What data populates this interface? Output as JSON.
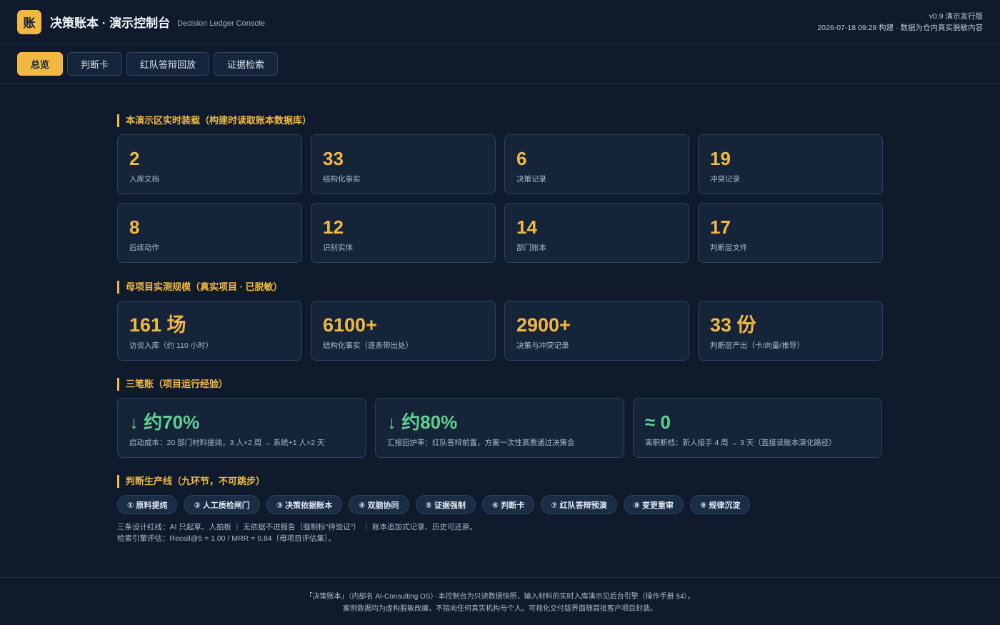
{
  "header": {
    "logo_char": "账",
    "title": "决策账本 · 演示控制台",
    "subtitle": "Decision Ledger Console",
    "version": "v0.9 演示发行版",
    "build_info": "2026-07-18 09:29 构建 · 数据为仓内真实脱敏内容"
  },
  "tabs": [
    {
      "label": "总览",
      "active": true
    },
    {
      "label": "判断卡",
      "active": false
    },
    {
      "label": "红队答辩回放",
      "active": false
    },
    {
      "label": "证据检索",
      "active": false
    }
  ],
  "section_live": {
    "title": "本演示区实时装载（构建时读取账本数据库）",
    "cards": [
      {
        "value": "2",
        "label": "入库文档"
      },
      {
        "value": "33",
        "label": "结构化事实"
      },
      {
        "value": "6",
        "label": "决策记录"
      },
      {
        "value": "19",
        "label": "冲突记录"
      },
      {
        "value": "8",
        "label": "后续动作"
      },
      {
        "value": "12",
        "label": "识别实体"
      },
      {
        "value": "14",
        "label": "部门账本"
      },
      {
        "value": "17",
        "label": "判断层文件"
      }
    ]
  },
  "section_scale": {
    "title": "母项目实测规模（真实项目 · 已脱敏）",
    "cards": [
      {
        "value": "161 场",
        "label": "访谈入库（约 110 小时）"
      },
      {
        "value": "6100+",
        "label": "结构化事实（逐条带出处）"
      },
      {
        "value": "2900+",
        "label": "决策与冲突记录"
      },
      {
        "value": "33 份",
        "label": "判断层产出（卡/向量/推导）"
      }
    ]
  },
  "section_ledgers": {
    "title": "三笔账（项目运行经验）",
    "cards": [
      {
        "value": "↓ 约70%",
        "label": "启动成本：20 部门材料提纯，3 人×2 周 → 系统+1 人×2 天"
      },
      {
        "value": "↓ 约80%",
        "label": "汇报回炉率：红队答辩前置，方案一次性高票通过决策会"
      },
      {
        "value": "≈ 0",
        "label": "离职断档：新人接手 4 周 → 3 天（直接读账本演化路径）"
      }
    ]
  },
  "section_pipeline": {
    "title": "判断生产线（九环节，不可跳步）",
    "steps": [
      "① 原料提纯",
      "② 人工质检闸门",
      "③ 决策依据账本",
      "④ 双脑协同",
      "⑤ 证据强制",
      "⑥ 判断卡",
      "⑦ 红队答辩预演",
      "⑧ 变更重审",
      "⑨ 规律沉淀"
    ],
    "note1": "三条设计红线：AI 只起草、人拍板 ｜ 无依据不进报告（强制标“待验证”） ｜ 账本追加式记录、历史可还原。",
    "note2": "检索引擎评估：Recall@5 = 1.00 / MRR = 0.84（母项目评估集）。"
  },
  "footer": {
    "line1": "「决策账本」（内部名 AI-Consulting OS）· 本控制台为只读数据快照，输入材料的实时入库演示见后台引擎（操作手册 §4）。",
    "line2": "案例数据均为虚构脱敏改编，不指向任何真实机构与个人。可视化交付版界面随首批客户项目封装。"
  },
  "colors": {
    "accent": "#f0b840",
    "positive": "#5fd08f",
    "background": "#0f1b2d",
    "card": "#16243a"
  }
}
